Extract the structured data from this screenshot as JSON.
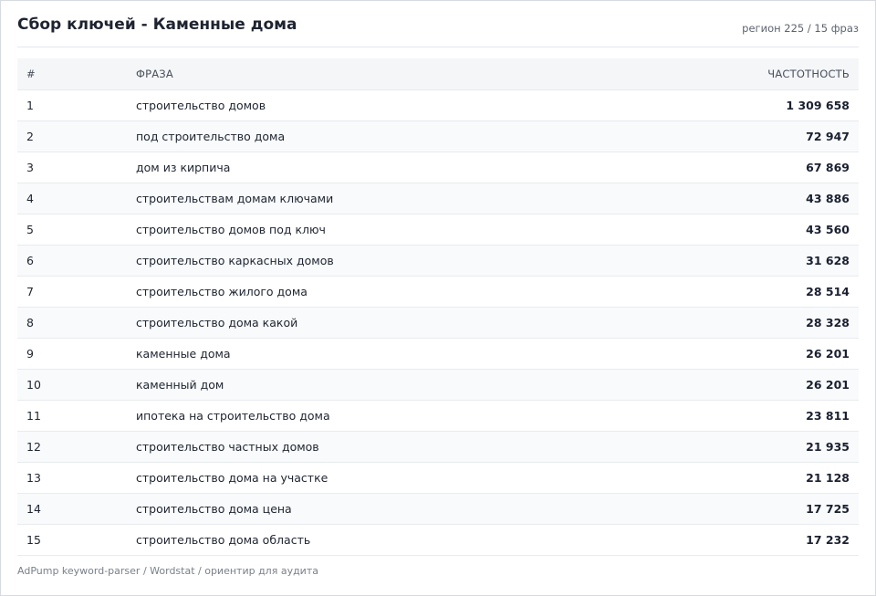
{
  "header": {
    "title": "Сбор ключей - Каменные дома",
    "meta": "регион 225 / 15 фраз"
  },
  "table": {
    "columns": {
      "num": "#",
      "phrase": "ФРАЗА",
      "freq": "ЧАСТОТНОСТЬ"
    },
    "rows": [
      {
        "num": "1",
        "phrase": "строительство домов",
        "freq": "1 309 658"
      },
      {
        "num": "2",
        "phrase": "под строительство дома",
        "freq": "72 947"
      },
      {
        "num": "3",
        "phrase": "дом из кирпича",
        "freq": "67 869"
      },
      {
        "num": "4",
        "phrase": "строительствам домам ключами",
        "freq": "43 886"
      },
      {
        "num": "5",
        "phrase": "строительство домов под ключ",
        "freq": "43 560"
      },
      {
        "num": "6",
        "phrase": "строительство каркасных домов",
        "freq": "31 628"
      },
      {
        "num": "7",
        "phrase": "строительство жилого дома",
        "freq": "28 514"
      },
      {
        "num": "8",
        "phrase": "строительство дома какой",
        "freq": "28 328"
      },
      {
        "num": "9",
        "phrase": "каменные дома",
        "freq": "26 201"
      },
      {
        "num": "10",
        "phrase": "каменный дом",
        "freq": "26 201"
      },
      {
        "num": "11",
        "phrase": "ипотека на строительство дома",
        "freq": "23 811"
      },
      {
        "num": "12",
        "phrase": "строительство частных домов",
        "freq": "21 935"
      },
      {
        "num": "13",
        "phrase": "строительство дома на участке",
        "freq": "21 128"
      },
      {
        "num": "14",
        "phrase": "строительство дома цена",
        "freq": "17 725"
      },
      {
        "num": "15",
        "phrase": "строительство дома область",
        "freq": "17 232"
      }
    ]
  },
  "footer": {
    "text": "AdPump keyword-parser / Wordstat / ориентир для аудита"
  }
}
